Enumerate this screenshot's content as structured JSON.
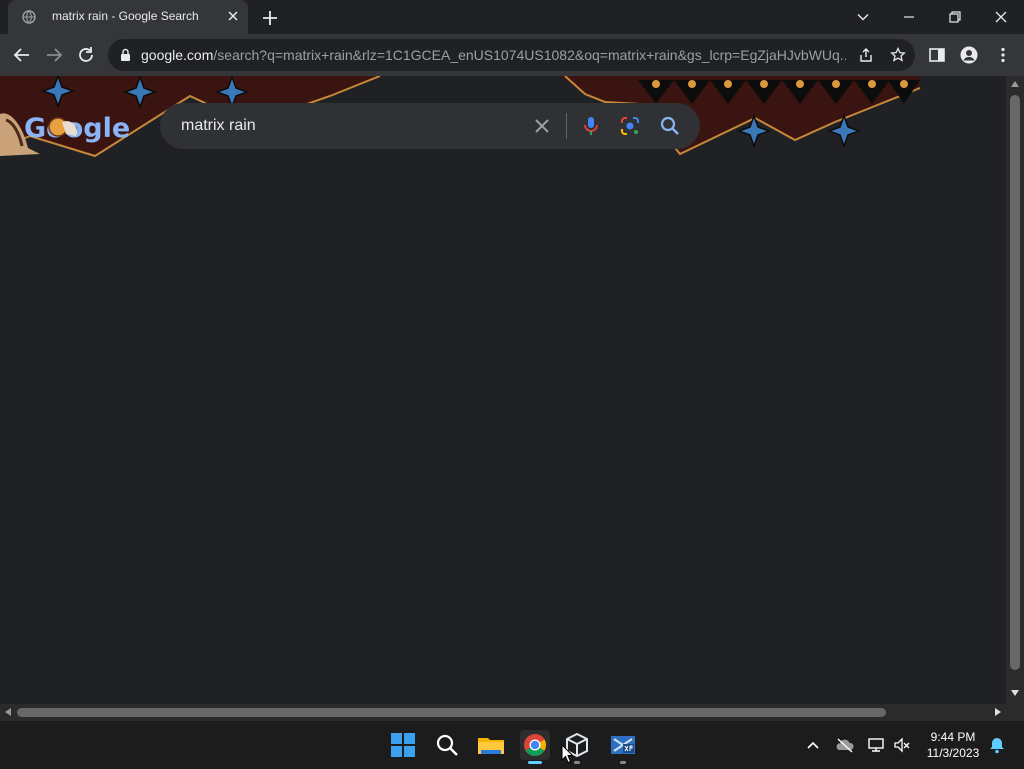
{
  "tab": {
    "title": "matrix rain - Google Search"
  },
  "omnibox": {
    "host": "google.com",
    "path": "/search?q=matrix+rain&rlz=1C1GCEA_enUS1074US1082&oq=matrix+rain&gs_lcrp=EgZjaHJvbWUq..."
  },
  "search": {
    "query": "matrix rain"
  },
  "doodle": {
    "logo_text": "Google"
  },
  "taskbar": {
    "time": "9:44 PM",
    "date": "11/3/2023"
  },
  "colors": {
    "accent": "#8ab4f8",
    "doodle_dark": "#3a1410",
    "doodle_line": "#c8883a",
    "star": "#3a78b8"
  }
}
